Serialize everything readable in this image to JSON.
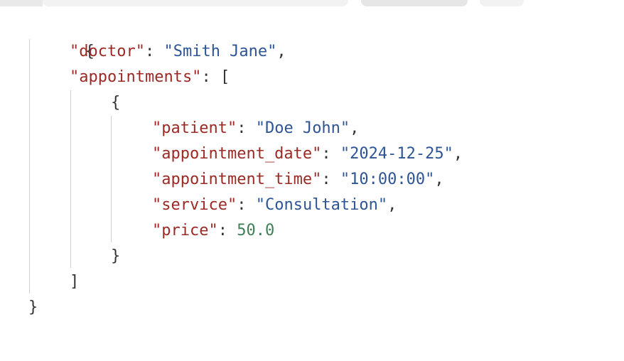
{
  "tabs": [
    {
      "id": "tab-1"
    },
    {
      "id": "tab-2"
    },
    {
      "id": "tab-3"
    },
    {
      "id": "tab-4"
    }
  ],
  "json_view": {
    "open_brace": "{",
    "close_brace": "}",
    "doctor_key": "\"doctor\"",
    "doctor_value": "\"Smith Jane\"",
    "appointments_key": "\"appointments\"",
    "array_open": "[",
    "array_close": "]",
    "item_open": "{",
    "item_close": "}",
    "patient_key": "\"patient\"",
    "patient_value": "\"Doe John\"",
    "date_key": "\"appointment_date\"",
    "date_value": "\"2024-12-25\"",
    "time_key": "\"appointment_time\"",
    "time_value": "\"10:00:00\"",
    "service_key": "\"service\"",
    "service_value": "\"Consultation\"",
    "price_key": "\"price\"",
    "price_value": "50.0",
    "colon": ": ",
    "comma": ","
  },
  "colors": {
    "key": "#9b2a24",
    "string": "#2d5596",
    "number": "#3f7f55",
    "punctuation": "#333333",
    "guide": "#cfcfd2"
  }
}
